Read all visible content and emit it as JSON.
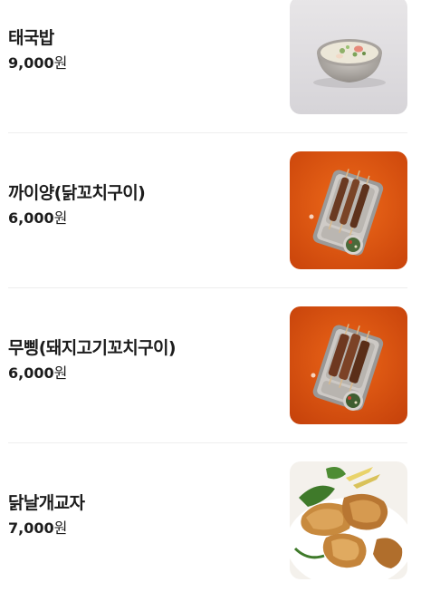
{
  "menu": {
    "items": [
      {
        "name": "태국밥",
        "price": "9,000",
        "currency": "원",
        "image": "rice-soup-bowl"
      },
      {
        "name": "까이양(닭꼬치구이)",
        "price": "6,000",
        "currency": "원",
        "image": "chicken-skewers-tray"
      },
      {
        "name": "무삥(돼지고기꼬치구이)",
        "price": "6,000",
        "currency": "원",
        "image": "pork-skewers-tray"
      },
      {
        "name": "닭날개교자",
        "price": "7,000",
        "currency": "원",
        "image": "chicken-wing-dumplings"
      }
    ]
  },
  "colors": {
    "text": "#1c1c1c",
    "divider": "#eeeeee",
    "orange_bg": "#e2540d"
  }
}
